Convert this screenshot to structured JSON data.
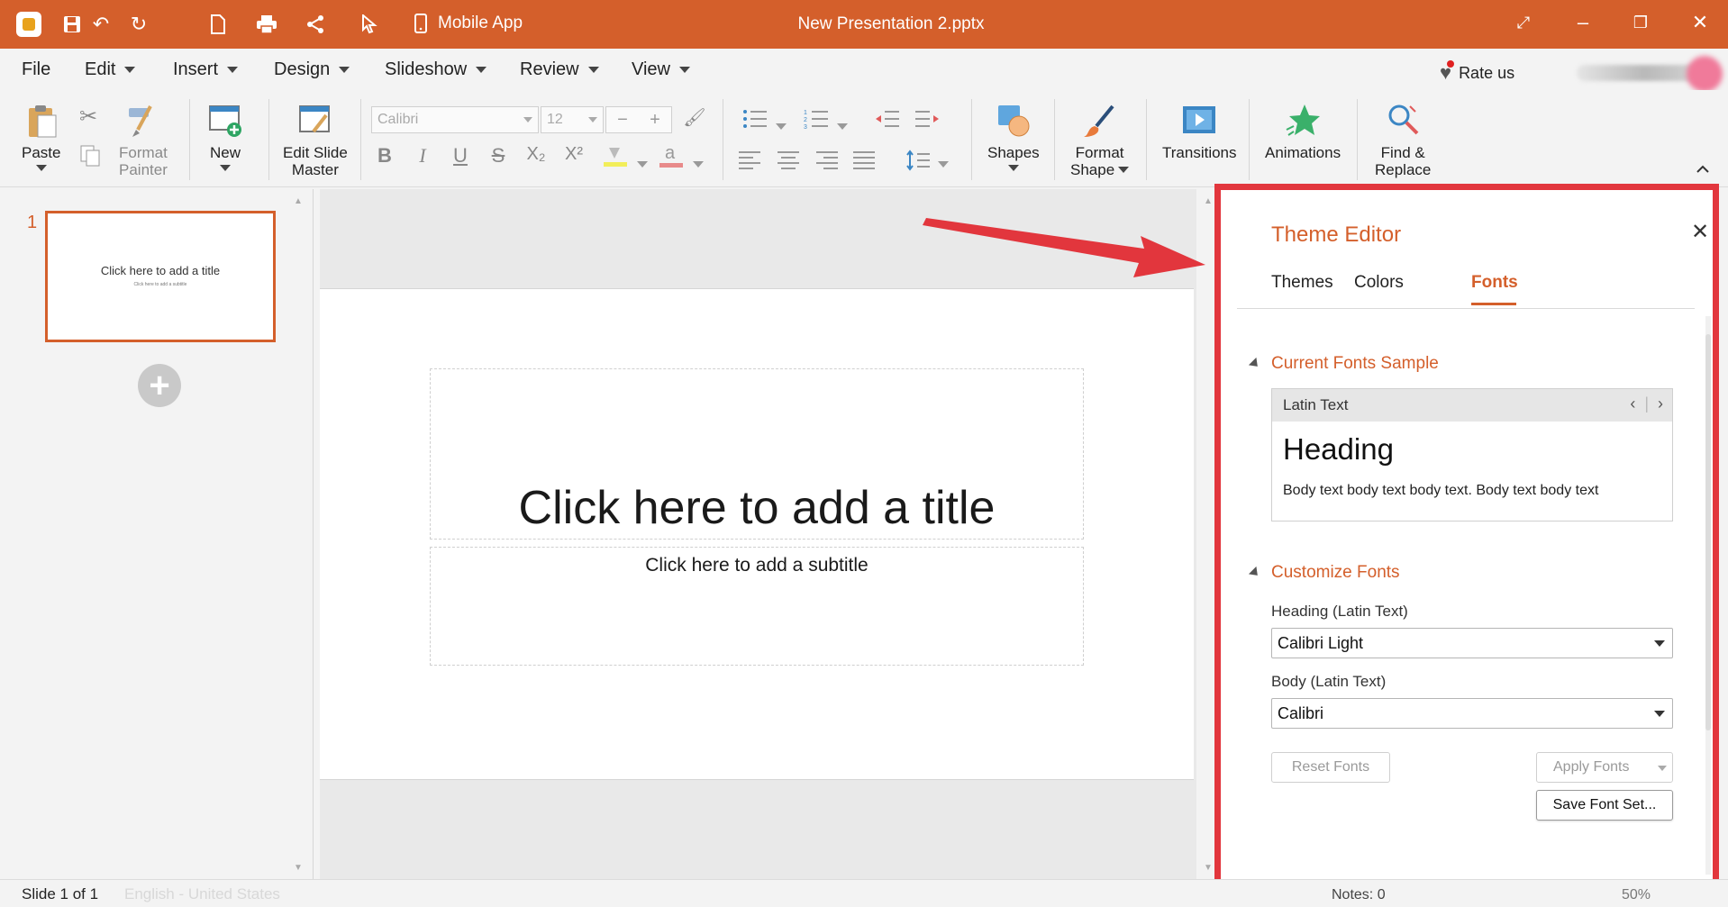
{
  "titlebar": {
    "mobile_app": "Mobile App",
    "document_title": "New Presentation 2.pptx",
    "accent": "#d45f2b"
  },
  "menu": {
    "items": [
      "File",
      "Edit",
      "Insert",
      "Design",
      "Slideshow",
      "Review",
      "View"
    ],
    "rate_us": "Rate us"
  },
  "ribbon": {
    "paste": "Paste",
    "format_painter": [
      "Format",
      "Painter"
    ],
    "new": "New",
    "edit_slide_master": [
      "Edit Slide",
      "Master"
    ],
    "font_name": "Calibri",
    "font_size": "12",
    "shapes": "Shapes",
    "format_shape": [
      "Format",
      "Shape"
    ],
    "transitions": "Transitions",
    "animations": "Animations",
    "find_replace": [
      "Find &",
      "Replace"
    ]
  },
  "slides_panel": {
    "slide_number": "1",
    "thumb_title": "Click here to add a title",
    "thumb_subtitle": "Click here to add a subtitle"
  },
  "slide": {
    "title_placeholder": "Click here to add a title",
    "subtitle_placeholder": "Click here to add a subtitle"
  },
  "theme_editor": {
    "title": "Theme Editor",
    "tabs": [
      "Themes",
      "Colors",
      "Fonts"
    ],
    "active_tab": "Fonts",
    "current_sample_header": "Current Fonts Sample",
    "sample_label": "Latin Text",
    "sample_heading": "Heading",
    "sample_body": "Body text body text body text. Body text body text",
    "customize_header": "Customize Fonts",
    "heading_label": "Heading (Latin Text)",
    "heading_value": "Calibri Light",
    "body_label": "Body (Latin Text)",
    "body_value": "Calibri",
    "reset_button": "Reset Fonts",
    "apply_button": "Apply Fonts",
    "save_button": "Save Font Set...",
    "border_color": "#e2363d"
  },
  "statusbar": {
    "slide_info": "Slide 1 of 1",
    "language": "English - United States",
    "notes": "Notes: 0",
    "zoom": "50%"
  }
}
